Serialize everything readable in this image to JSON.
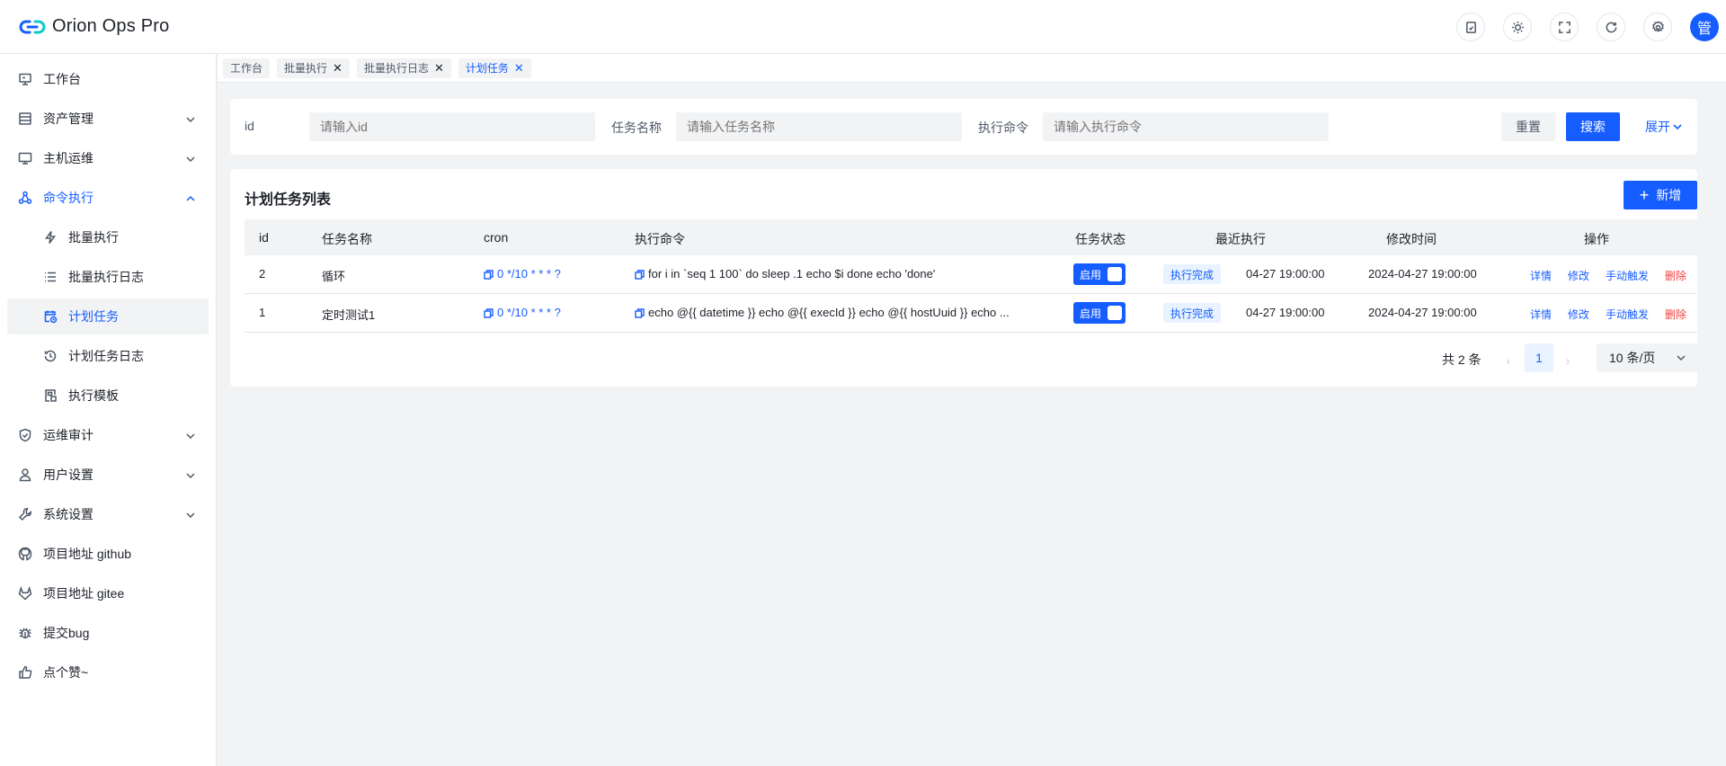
{
  "app": {
    "title": "Orion Ops Pro",
    "avatar_text": "管"
  },
  "header_icons": [
    "doc-icon",
    "sun-icon",
    "fullscreen-icon",
    "refresh-icon",
    "settings-icon"
  ],
  "sidebar": {
    "items": [
      {
        "label": "工作台",
        "icon": "monitor-icon"
      },
      {
        "label": "资产管理",
        "icon": "list-icon",
        "expandable": true
      },
      {
        "label": "主机运维",
        "icon": "desktop-icon",
        "expandable": true
      },
      {
        "label": "命令执行",
        "icon": "triangle-nodes-icon",
        "expandable": true,
        "open": true,
        "children": [
          {
            "label": "批量执行",
            "icon": "bolt-icon"
          },
          {
            "label": "批量执行日志",
            "icon": "list-lines-icon"
          },
          {
            "label": "计划任务",
            "icon": "calendar-clock-icon",
            "active": true
          },
          {
            "label": "计划任务日志",
            "icon": "history-icon"
          },
          {
            "label": "执行模板",
            "icon": "template-icon"
          }
        ]
      },
      {
        "label": "运维审计",
        "icon": "shield-icon",
        "expandable": true
      },
      {
        "label": "用户设置",
        "icon": "user-icon",
        "expandable": true
      },
      {
        "label": "系统设置",
        "icon": "wrench-icon",
        "expandable": true
      },
      {
        "label": "项目地址 github",
        "icon": "github-icon"
      },
      {
        "label": "项目地址 gitee",
        "icon": "gitee-icon"
      },
      {
        "label": "提交bug",
        "icon": "bug-icon"
      },
      {
        "label": "点个赞~",
        "icon": "thumb-up-icon"
      }
    ]
  },
  "tabs": [
    {
      "label": "工作台",
      "closable": false
    },
    {
      "label": "批量执行",
      "closable": true
    },
    {
      "label": "批量执行日志",
      "closable": true
    },
    {
      "label": "计划任务",
      "closable": true,
      "active": true
    }
  ],
  "search": {
    "id_label": "id",
    "id_placeholder": "请输入id",
    "name_label": "任务名称",
    "name_placeholder": "请输入任务名称",
    "command_label": "执行命令",
    "command_placeholder": "请输入执行命令",
    "reset_label": "重置",
    "search_label": "搜索",
    "expand_label": "展开"
  },
  "table": {
    "title": "计划任务列表",
    "add_label": "新增",
    "columns": [
      "id",
      "任务名称",
      "cron",
      "执行命令",
      "任务状态",
      "最近执行",
      "修改时间",
      "操作"
    ],
    "rows": [
      {
        "id": "2",
        "name": "循环",
        "cron": "0 */10 * * * ?",
        "command": "for i in `seq 1 100` do sleep .1 echo $i done echo 'done'",
        "status": "启用",
        "last_tag": "执行完成",
        "last_time": "04-27 19:00:00",
        "modified": "2024-04-27 19:00:00",
        "actions": [
          "详情",
          "修改",
          "手动触发",
          "删除"
        ]
      },
      {
        "id": "1",
        "name": "定时测试1",
        "cron": "0 */10 * * * ?",
        "command": "echo @{{ datetime }} echo @{{ execId }} echo @{{ hostUuid }} echo ...",
        "status": "启用",
        "last_tag": "执行完成",
        "last_time": "04-27 19:00:00",
        "modified": "2024-04-27 19:00:00",
        "actions": [
          "详情",
          "修改",
          "手动触发",
          "删除"
        ]
      }
    ]
  },
  "pagination": {
    "total_text": "共 2 条",
    "current_page": "1",
    "page_size": "10 条/页"
  },
  "colors": {
    "primary": "#165dff",
    "danger": "#f53f3f",
    "bg": "#f2f3f5"
  }
}
